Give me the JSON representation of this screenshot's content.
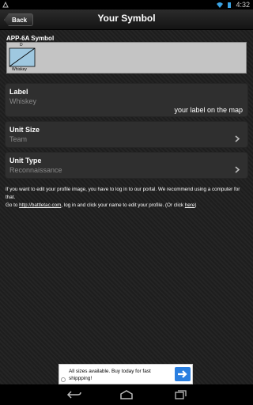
{
  "status_bar": {
    "time": "4:32"
  },
  "nav": {
    "back_label": "Back",
    "title": "Your Symbol"
  },
  "symbol": {
    "section_label": "APP-6A Symbol",
    "top_mark": "D",
    "label_text": "Whiskey"
  },
  "label_card": {
    "title": "Label",
    "value": "Whiskey",
    "hint": "your label on the map"
  },
  "unit_size_card": {
    "title": "Unit Size",
    "value": "Team"
  },
  "unit_type_card": {
    "title": "Unit Type",
    "value": "Reconnaissance"
  },
  "info": {
    "paragraph_1": "If you want to edit your profile image, you have to log in to our portal. We recommend using a computer for that.",
    "go_to": "Go to ",
    "portal_link": "http://battletac.com",
    "middle_text": ", log in and click your name to edit your profile. (Or click ",
    "here_link": "here",
    "closing": ")"
  },
  "ad": {
    "text": "All sizes available. Buy today for fast shippping!"
  },
  "colors": {
    "accent_ad": "#2a7fe0",
    "card_bg": "#2f2f2f"
  }
}
